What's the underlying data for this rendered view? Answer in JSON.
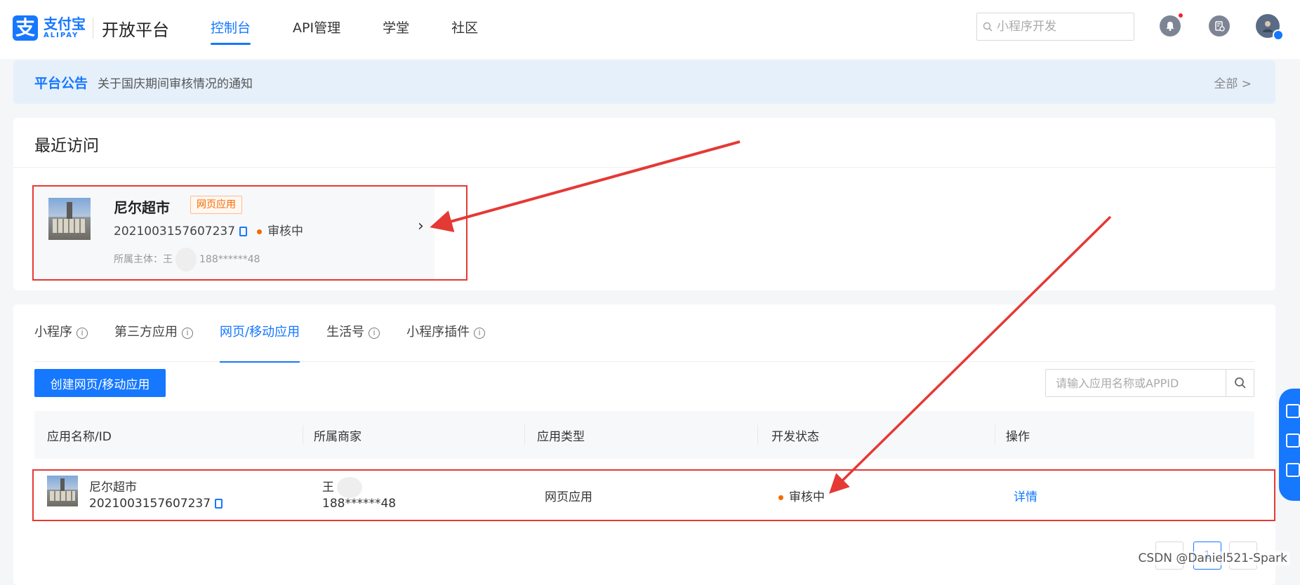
{
  "header": {
    "logo_cn": "支付宝",
    "logo_en": "ALIPAY",
    "platform": "开放平台",
    "nav": [
      "控制台",
      "API管理",
      "学堂",
      "社区"
    ],
    "search_placeholder": "小程序开发"
  },
  "announcement": {
    "title": "平台公告",
    "text": "关于国庆期间审核情况的通知",
    "all_label": "全部 >"
  },
  "recent": {
    "title": "最近访问",
    "app": {
      "name": "尼尔超市",
      "tag": "网页应用",
      "id": "2021003157607237",
      "status": "审核中",
      "owner_label": "所属主体：王",
      "owner_phone": "188******48"
    }
  },
  "tabs": [
    "小程序",
    "第三方应用",
    "网页/移动应用",
    "生活号",
    "小程序插件"
  ],
  "actions": {
    "create_label": "创建网页/移动应用",
    "search_placeholder": "请输入应用名称或APPID"
  },
  "table": {
    "headers": [
      "应用名称/ID",
      "所属商家",
      "应用类型",
      "开发状态",
      "操作"
    ],
    "rows": [
      {
        "name": "尼尔超市",
        "id": "2021003157607237",
        "merchant_name": "王",
        "merchant_phone": "188******48",
        "type": "网页应用",
        "status": "审核中",
        "action": "详情"
      }
    ]
  },
  "pagination": {
    "current": "1"
  },
  "watermark": "CSDN @Daniel521-Spark",
  "colors": {
    "accent": "#1677ff",
    "status_orange": "#f56a00",
    "annotation_red": "#e53935"
  }
}
